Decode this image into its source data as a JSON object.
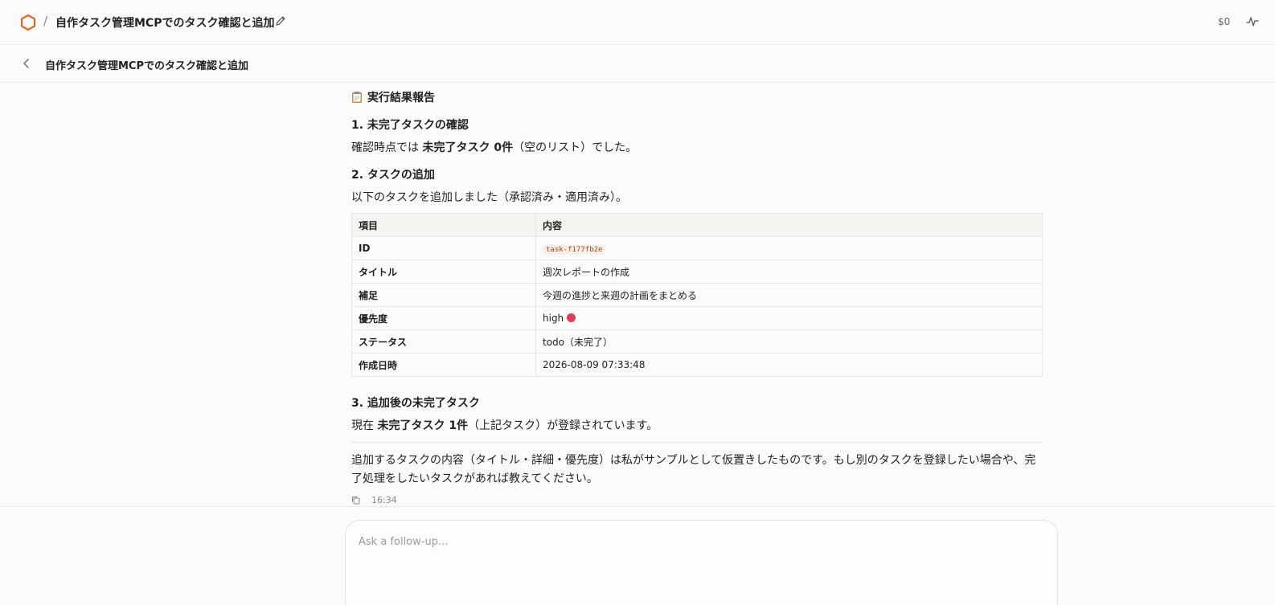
{
  "header": {
    "breadcrumb_separator": "/",
    "title": "自作タスク管理MCPでのタスク確認と追加",
    "cost": "$0",
    "accent_color": "#e8622c"
  },
  "subheader": {
    "title": "自作タスク管理MCPでのタスク確認と追加"
  },
  "report": {
    "heading": "実行結果報告",
    "sections": [
      {
        "title": "1. 未完了タスクの確認",
        "text_before": "確認時点では ",
        "text_bold": "未完了タスク 0件",
        "text_after": "（空のリスト）でした。"
      },
      {
        "title": "2. タスクの追加",
        "text": "以下のタスクを追加しました（承認済み・適用済み）。"
      },
      {
        "title": "3. 追加後の未完了タスク",
        "text_before": "現在 ",
        "text_bold": "未完了タスク 1件",
        "text_after": "（上記タスク）が登録されています。"
      }
    ],
    "table": {
      "headers": [
        "項目",
        "内容"
      ],
      "rows": [
        {
          "key": "ID",
          "value": "task-f177fb2e"
        },
        {
          "key": "タイトル",
          "value": "週次レポートの作成"
        },
        {
          "key": "補足",
          "value": "今週の進捗と来週の計画をまとめる"
        },
        {
          "key": "優先度",
          "value": "high"
        },
        {
          "key": "ステータス",
          "value": "todo（未完了）"
        },
        {
          "key": "作成日時",
          "value": "2026-08-09 07:33:48"
        }
      ]
    },
    "note": "追加するタスクの内容（タイトル・詳細・優先度）は私がサンプルとして仮置きしたものです。もし別のタスクを登録したい場合や、完了処理をしたいタスクがあれば教えてください。",
    "time": "16:34"
  },
  "composer": {
    "placeholder": "Ask a follow-up..."
  }
}
